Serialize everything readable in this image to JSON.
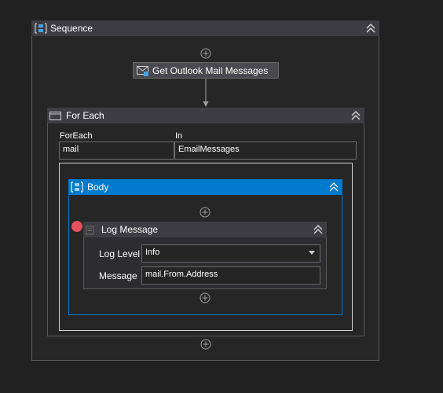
{
  "sequence": {
    "title": "Sequence"
  },
  "get_outlook": {
    "label": "Get Outlook Mail Messages"
  },
  "for_each": {
    "title": "For Each",
    "foreach_label": "ForEach",
    "foreach_value": "mail",
    "in_label": "In",
    "in_value": "EmailMessages"
  },
  "body": {
    "title": "Body"
  },
  "log_message": {
    "title": "Log Message",
    "log_level_label": "Log Level",
    "log_level_value": "Info",
    "message_label": "Message",
    "message_value": "mail.From.Address"
  },
  "colors": {
    "canvas": "#212121",
    "header": "#3e3e42",
    "accent": "#007acc",
    "breakpoint": "#e4505c",
    "sequence_icon": "#4aa3df"
  }
}
